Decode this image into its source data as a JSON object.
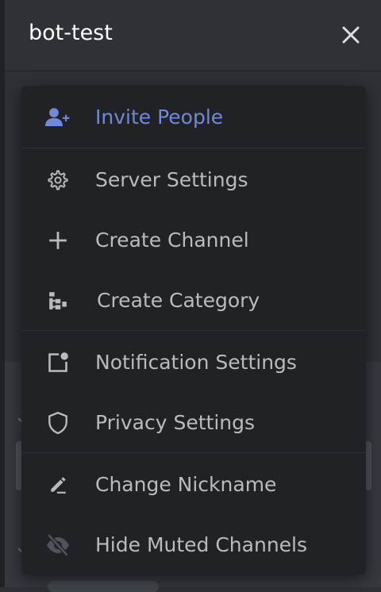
{
  "header": {
    "server_name": "bot-test",
    "close_icon": "close-icon"
  },
  "menu": {
    "items": [
      {
        "label": "Invite People",
        "icon": "add-person-icon",
        "accent": "#7289da"
      },
      {
        "label": "Server Settings",
        "icon": "gear-icon"
      },
      {
        "label": "Create Channel",
        "icon": "plus-icon"
      },
      {
        "label": "Create Category",
        "icon": "category-icon"
      },
      {
        "label": "Notification Settings",
        "icon": "notification-icon"
      },
      {
        "label": "Privacy Settings",
        "icon": "shield-icon"
      },
      {
        "label": "Change Nickname",
        "icon": "pencil-icon"
      },
      {
        "label": "Hide Muted Channels",
        "icon": "eye-slash-icon"
      }
    ]
  },
  "colors": {
    "background": "#2f3136",
    "menu_background": "#202225",
    "text": "#b9bbbe",
    "accent": "#7289da",
    "header_text": "#ffffff"
  }
}
